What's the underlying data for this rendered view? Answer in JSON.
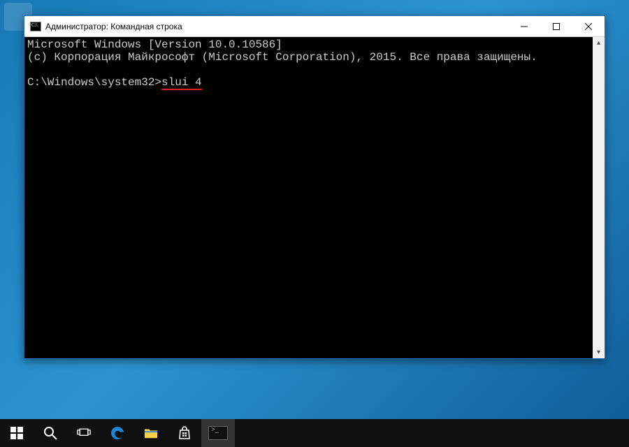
{
  "window": {
    "title": "Администратор: Командная строка"
  },
  "console": {
    "line1": "Microsoft Windows [Version 10.0.10586]",
    "line2": "(c) Корпорация Майкрософт (Microsoft Corporation), 2015. Все права защищены.",
    "prompt_path": "C:\\Windows\\system32>",
    "command": "slui 4"
  },
  "taskbar": {
    "items": [
      {
        "name": "start"
      },
      {
        "name": "search"
      },
      {
        "name": "taskview"
      },
      {
        "name": "edge"
      },
      {
        "name": "explorer"
      },
      {
        "name": "store"
      },
      {
        "name": "cmd",
        "active": true
      }
    ]
  }
}
